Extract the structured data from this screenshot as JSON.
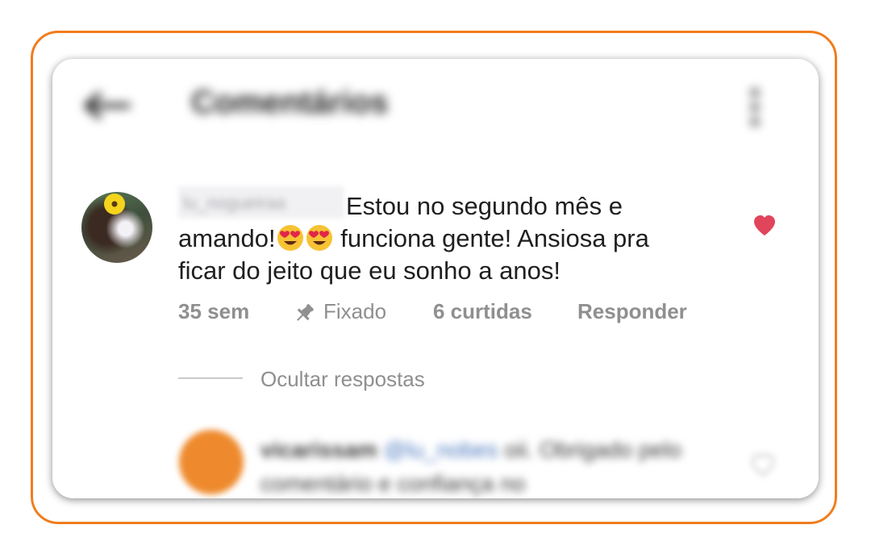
{
  "header": {
    "title": "Comentários"
  },
  "comment": {
    "username": "lu_nogueiraa",
    "line1": "Estou no segundo mês e",
    "line2_before": "amando!",
    "line2_after": " funciona gente! Ansiosa pra",
    "line3": "ficar do jeito que eu sonho a anos!",
    "emojis": [
      "heart-eyes-emoji",
      "heart-eyes-emoji"
    ],
    "age": "35 sem",
    "pinned_label": "Fixado",
    "likes": "6 curtidas",
    "reply_label": "Responder",
    "liked_color": "#e0455b"
  },
  "replies": {
    "toggle_label": "Ocultar respostas",
    "first": {
      "username": "vicarissam",
      "mention": "@lu_nobes",
      "text": "oii. Obrigado pelo comentário e confiança no"
    }
  },
  "colors": {
    "frame_border": "#f07d1c",
    "meta_text": "#8f8f8f"
  }
}
